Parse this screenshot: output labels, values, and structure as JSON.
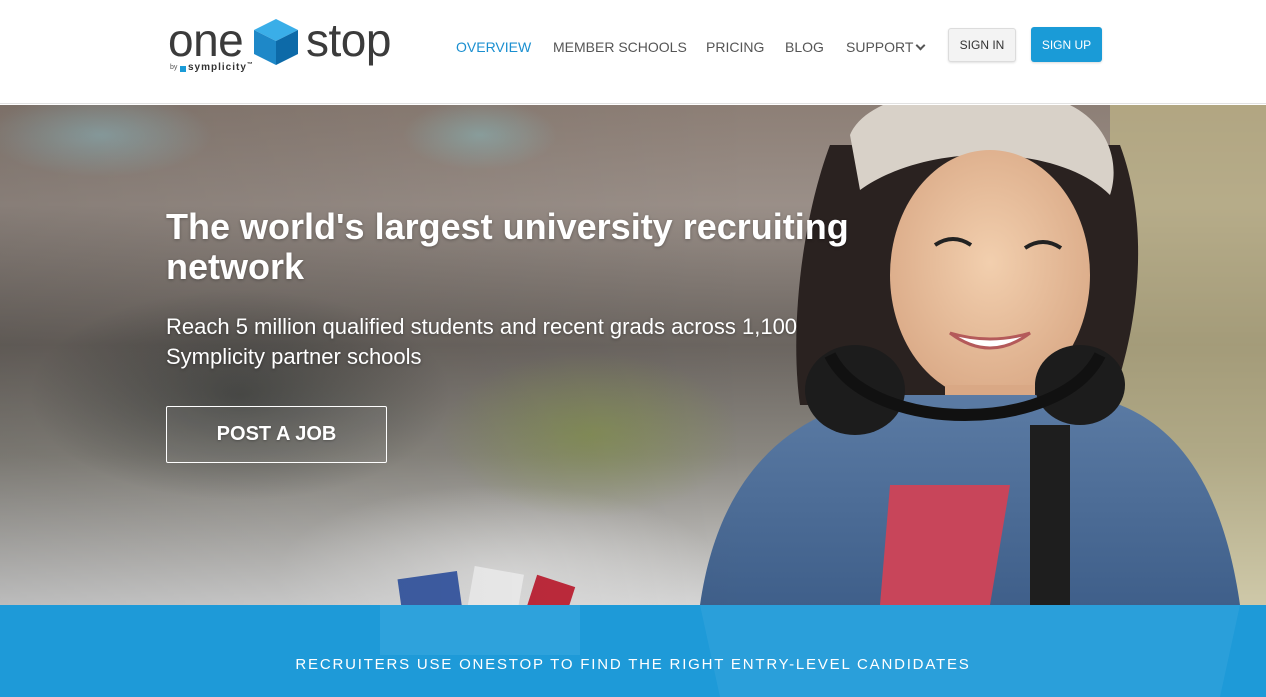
{
  "brand": {
    "word_left": "one",
    "word_right": "stop",
    "by": "by",
    "company": "symplicity",
    "trademark": "™",
    "cube_colors": [
      "#1e88c8",
      "#3aaee8",
      "#0d6aa8"
    ]
  },
  "nav": {
    "items": [
      {
        "label": "OVERVIEW",
        "active": true
      },
      {
        "label": "MEMBER SCHOOLS",
        "active": false
      },
      {
        "label": "PRICING",
        "active": false
      },
      {
        "label": "BLOG",
        "active": false
      },
      {
        "label": "SUPPORT",
        "active": false,
        "icon": "chevron-down-icon"
      }
    ],
    "active_color": "#1a8fd0"
  },
  "header_actions": {
    "sign_in": "SIGN IN",
    "sign_up": "SIGN UP",
    "accent": "#1a9bd7"
  },
  "hero": {
    "title": "The world's largest university recruiting network",
    "subtitle": "Reach 5 million qualified students and recent grads across 1,100 Symplicity partner schools",
    "cta": "POST A JOB"
  },
  "band": {
    "text": "RECRUITERS USE ONESTOP TO FIND THE RIGHT ENTRY-LEVEL CANDIDATES",
    "color": "#1e9ad8"
  }
}
